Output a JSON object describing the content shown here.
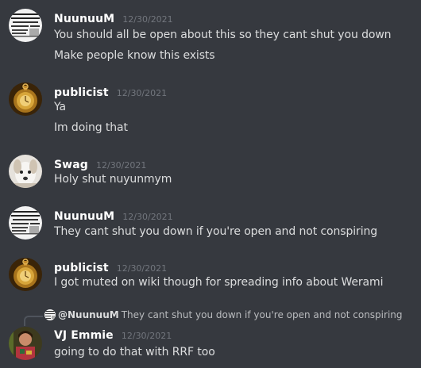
{
  "messages": [
    {
      "username": "NuunuuM",
      "timestamp": "12/30/2021",
      "lines": [
        "You should all be open about this so they cant shut you down",
        "Make people know this exists"
      ]
    },
    {
      "username": "publicist",
      "timestamp": "12/30/2021",
      "lines": [
        "Ya",
        "Im doing that"
      ]
    },
    {
      "username": "Swag",
      "timestamp": "12/30/2021",
      "lines": [
        "Holy shut nuyunmym"
      ]
    },
    {
      "username": "NuunuuM",
      "timestamp": "12/30/2021",
      "lines": [
        "They cant shut you down if you're open and not conspiring"
      ]
    },
    {
      "username": "publicist",
      "timestamp": "12/30/2021",
      "lines": [
        "I got muted on wiki though for spreading info about Werami"
      ]
    },
    {
      "username": "VJ Emmie",
      "timestamp": "12/30/2021",
      "lines": [
        "going to do that with RRF too"
      ],
      "reply": {
        "mention": "@NuunuuM",
        "preview": "They cant shut you down if you're open and not conspiring"
      }
    }
  ],
  "colors": {
    "background": "#36393f",
    "username": "#ffffff",
    "timestamp": "#72767d",
    "message_text": "#dcddde",
    "reply_line": "#4f545c"
  },
  "icons": {
    "nuunuum_avatar": "newspaper-clipping-avatar",
    "publicist_avatar": "golden-pocket-watch-avatar",
    "swag_avatar": "white-dog-avatar",
    "vj_emmie_avatar": "person-photo-avatar"
  }
}
